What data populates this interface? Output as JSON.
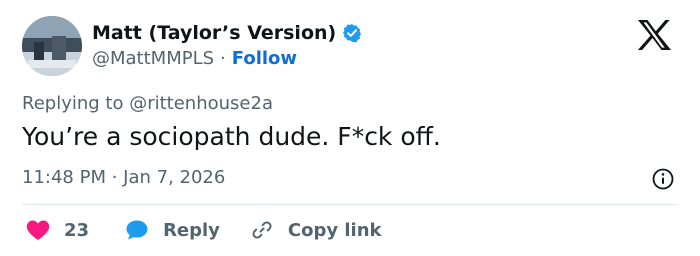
{
  "author": {
    "display_name": "Matt (Taylor’s Version)",
    "handle": "@MattMMPLS",
    "separator": "·",
    "follow_label": "Follow",
    "verified": true
  },
  "reply_context": {
    "prefix": "Replying to",
    "mention": "@rittenhouse2a"
  },
  "tweet": {
    "text": "You’re a sociopath dude. F*ck off.",
    "timestamp": "11:48 PM · Jan 7, 2026"
  },
  "actions": {
    "like_count": "23",
    "reply_label": "Reply",
    "copy_label": "Copy link"
  },
  "colors": {
    "accent": "#0f6dd3",
    "like": "#f91880",
    "verified": "#1d9bf0",
    "secondary_text": "#536471"
  },
  "icons": [
    "x-logo-icon",
    "verified-badge-icon",
    "heart-icon",
    "reply-bubble-icon",
    "link-icon",
    "info-icon"
  ]
}
